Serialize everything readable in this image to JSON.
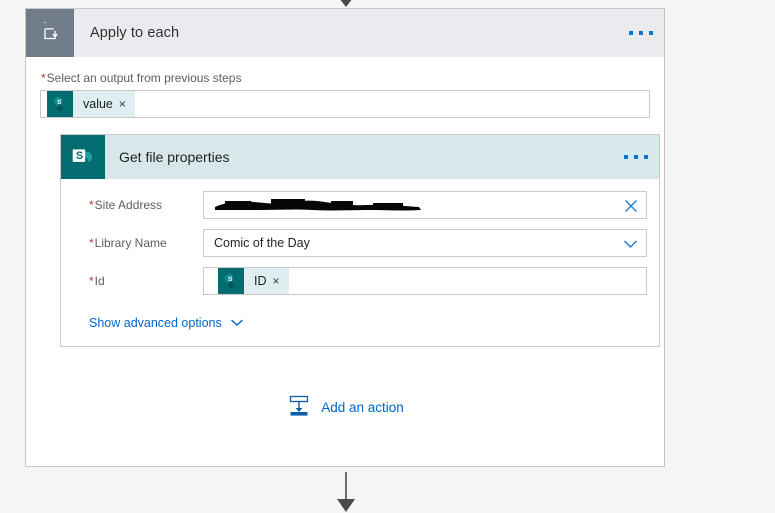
{
  "canvas": {
    "background_color": "#f5f5f5",
    "connector_color": "#4a4a4a"
  },
  "scope": {
    "title": "Apply to each",
    "icon": "loop-repeat-icon",
    "header_bg": "#eaebee",
    "icon_bg": "#707c89",
    "menu_icon": "ellipsis-icon",
    "input": {
      "label": "Select an output from previous steps",
      "required_marker": "*",
      "token": {
        "text": "value",
        "remove_label": "×",
        "icon": "sharepoint-icon",
        "icon_bg": "#036c70",
        "pill_bg": "#dfeef0"
      }
    }
  },
  "action": {
    "title": "Get file properties",
    "icon": "sharepoint-icon",
    "header_bg": "#d8e8ea",
    "icon_bg": "#036c70",
    "menu_icon": "ellipsis-icon",
    "fields": [
      {
        "label": "Site Address",
        "required_marker": "*",
        "type": "text-redacted",
        "value": "",
        "trailing_icon": "close-x-icon"
      },
      {
        "label": "Library Name",
        "required_marker": "*",
        "type": "dropdown",
        "value": "Comic of the Day",
        "trailing_icon": "chevron-down-icon"
      },
      {
        "label": "Id",
        "required_marker": "*",
        "type": "token",
        "token": {
          "text": "ID",
          "remove_label": "×",
          "icon": "sharepoint-icon",
          "icon_bg": "#036c70",
          "pill_bg": "#dfeef0"
        }
      }
    ],
    "advanced_options": {
      "label": "Show advanced options",
      "icon": "chevron-down-icon"
    }
  },
  "add_action": {
    "label": "Add an action",
    "icon": "insert-action-icon",
    "color": "#0066cc"
  }
}
